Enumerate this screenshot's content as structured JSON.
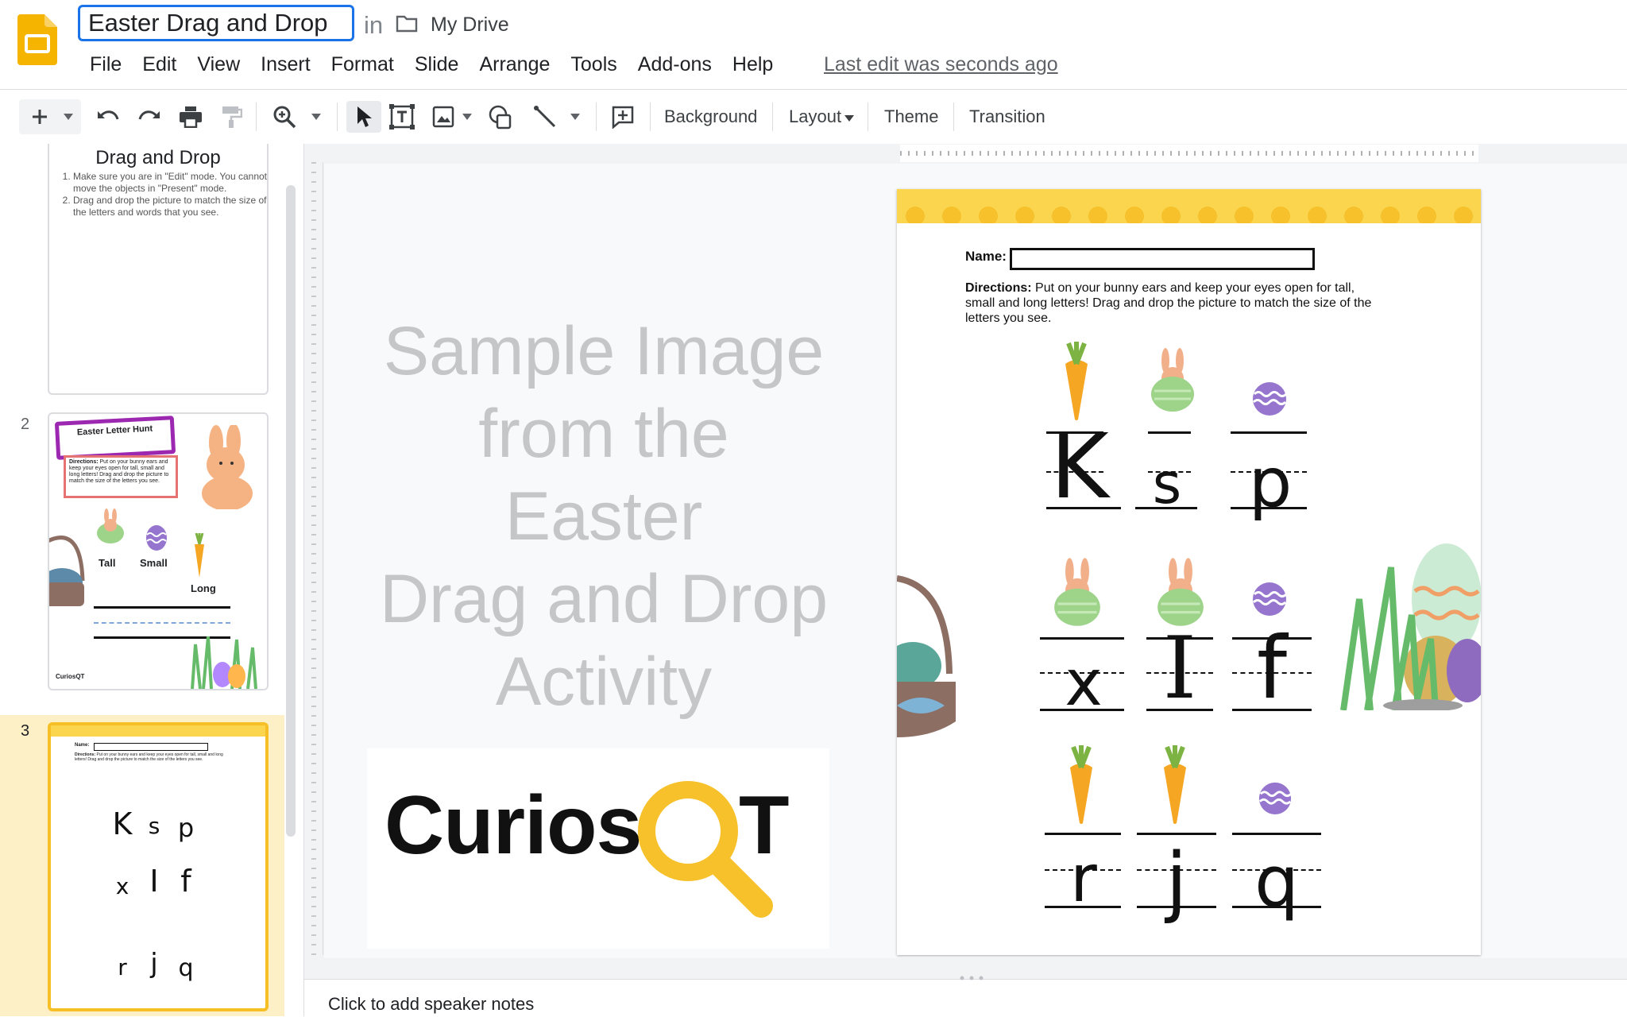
{
  "app": {
    "doc_title": "Easter Drag and Drop",
    "in_label": "in",
    "drive_name": "My Drive",
    "last_edit": "Last edit was seconds ago",
    "brand_color": "#f4b400"
  },
  "menu": [
    "File",
    "Edit",
    "View",
    "Insert",
    "Format",
    "Slide",
    "Arrange",
    "Tools",
    "Add-ons",
    "Help"
  ],
  "toolbar": {
    "background_label": "Background",
    "layout_label": "Layout",
    "theme_label": "Theme",
    "transition_label": "Transition"
  },
  "filmstrip": {
    "slide1": {
      "title": "Drag and Drop",
      "steps": [
        "Make sure you are in \"Edit\" mode. You cannot move the objects in \"Present\" mode.",
        "Drag and drop the picture to match the size of the letters and words that you see."
      ]
    },
    "slide2": {
      "number": "2",
      "banner": "Easter Letter Hunt",
      "directions_bold": "Directions:",
      "directions": "Put on your bunny ears and keep your eyes open for tall, small and long letters! Drag and drop the picture to match the size of the letters you see.",
      "labels": [
        "Tall",
        "Small",
        "Long"
      ],
      "logo": "CuriosQT"
    },
    "slide3": {
      "number": "3"
    }
  },
  "canvas": {
    "sample_lines": [
      "Sample Image",
      "from the",
      "Easter",
      "Drag and Drop",
      "Activity"
    ],
    "logo_text": "Curios",
    "logo_end": "T",
    "accent": "#f6c12a"
  },
  "worksheet": {
    "name_label": "Name:",
    "directions_bold": "Directions:",
    "directions": " Put on your bunny ears and keep your eyes open for tall, small and long letters! Drag and drop the picture to match the size of the letters you see.",
    "letters": [
      "K",
      "s",
      "p",
      "x",
      "I",
      "f",
      "r",
      "j",
      "q"
    ]
  },
  "notes": {
    "placeholder": "Click to add speaker notes"
  }
}
